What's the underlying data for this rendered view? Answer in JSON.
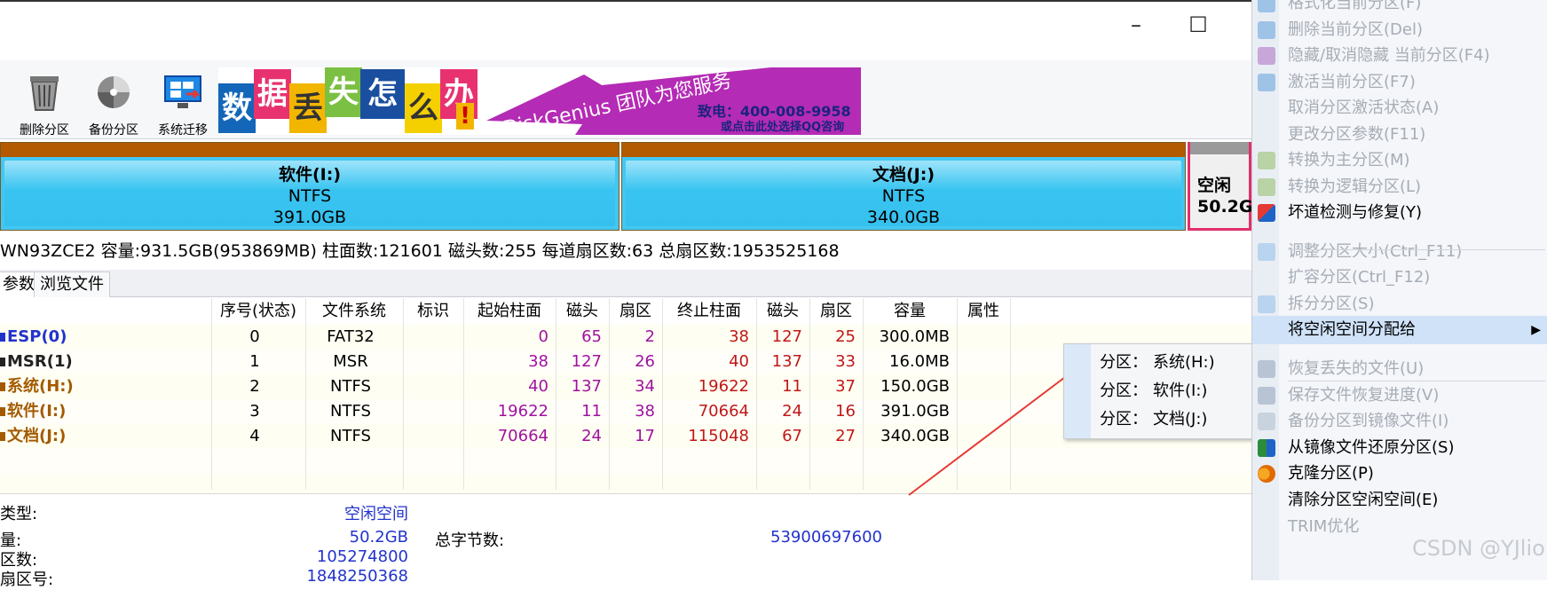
{
  "window": {
    "close_glyph": "✕",
    "maximize_glyph": "☐"
  },
  "toolbar": {
    "buttons": [
      {
        "label": "删除分区",
        "icon": "trash-icon"
      },
      {
        "label": "备份分区",
        "icon": "backup-icon"
      },
      {
        "label": "系统迁移",
        "icon": "system-migrate-icon"
      }
    ]
  },
  "banner": {
    "tiles": [
      "数",
      "据",
      "丢",
      "失",
      "怎",
      "么",
      "办",
      "!"
    ],
    "brand": "DiskGenius 团队为您服务",
    "phone": "致电：400-008-9958",
    "qq": "或点击此处选择QQ咨询"
  },
  "disk_map": {
    "partitions": [
      {
        "name": "软件(I:)",
        "fs": "NTFS",
        "size": "391.0GB"
      },
      {
        "name": "文档(J:)",
        "fs": "NTFS",
        "size": "340.0GB"
      },
      {
        "name": "空闲",
        "size": "50.2G"
      }
    ]
  },
  "disk_info": "WN93ZCE2  容量:931.5GB(953869MB)  柱面数:121601  磁头数:255  每道扇区数:63  总扇区数:1953525168",
  "tabs": [
    "参数",
    "浏览文件"
  ],
  "table": {
    "columns": [
      "序号(状态)",
      "文件系统",
      "标识",
      "起始柱面",
      "磁头",
      "扇区",
      "终止柱面",
      "磁头",
      "扇区",
      "容量",
      "属性"
    ],
    "rows": [
      {
        "name": "ESP(0)",
        "index": "0",
        "fs": "FAT32",
        "start_cyl": "0",
        "start_head": "65",
        "start_sec": "2",
        "end_cyl": "38",
        "end_head": "127",
        "end_sec": "25",
        "size": "300.0MB"
      },
      {
        "name": "MSR(1)",
        "index": "1",
        "fs": "MSR",
        "start_cyl": "38",
        "start_head": "127",
        "start_sec": "26",
        "end_cyl": "40",
        "end_head": "137",
        "end_sec": "33",
        "size": "16.0MB"
      },
      {
        "name": "系统(H:)",
        "index": "2",
        "fs": "NTFS",
        "start_cyl": "40",
        "start_head": "137",
        "start_sec": "34",
        "end_cyl": "19622",
        "end_head": "11",
        "end_sec": "37",
        "size": "150.0GB"
      },
      {
        "name": "软件(I:)",
        "index": "3",
        "fs": "NTFS",
        "start_cyl": "19622",
        "start_head": "11",
        "start_sec": "38",
        "end_cyl": "70664",
        "end_head": "24",
        "end_sec": "16",
        "size": "391.0GB"
      },
      {
        "name": "文档(J:)",
        "index": "4",
        "fs": "NTFS",
        "start_cyl": "70664",
        "start_head": "24",
        "start_sec": "17",
        "end_cyl": "115048",
        "end_head": "67",
        "end_sec": "27",
        "size": "340.0GB"
      }
    ]
  },
  "bottom_info": {
    "type_label": "类型:",
    "type_value": "空闲空间",
    "cap_label": "量:",
    "cap_value": "50.2GB",
    "total_bytes_label": "总字节数:",
    "total_bytes_value": "53900697600",
    "sectors_label": "区数:",
    "sectors_value": "105274800",
    "start_sector_label": "扇区号:",
    "start_sector_value": "1848250368"
  },
  "submenu": {
    "items": [
      {
        "prefix": "分区：",
        "value": "系统(H:)"
      },
      {
        "prefix": "分区：",
        "value": "软件(I:)"
      },
      {
        "prefix": "分区：",
        "value": "文档(J:)"
      }
    ]
  },
  "context_menu": {
    "items": [
      {
        "label": "格式化当前分区(F)",
        "enabled": false,
        "icon": "format-icon"
      },
      {
        "label": "删除当前分区(Del)",
        "enabled": false,
        "icon": "delete-icon"
      },
      {
        "label": "隐藏/取消隐藏 当前分区(F4)",
        "enabled": false,
        "icon": "hide-icon"
      },
      {
        "label": "激活当前分区(F7)",
        "enabled": false,
        "icon": "activate-icon"
      },
      {
        "label": "取消分区激活状态(A)",
        "enabled": false,
        "icon": ""
      },
      {
        "label": "更改分区参数(F11)",
        "enabled": false,
        "icon": ""
      },
      {
        "label": "转换为主分区(M)",
        "enabled": false,
        "icon": "convert-primary-icon"
      },
      {
        "label": "转换为逻辑分区(L)",
        "enabled": false,
        "icon": "convert-logical-icon"
      },
      {
        "label": "坏道检测与修复(Y)",
        "enabled": true,
        "icon": "repair-tools-icon"
      },
      {
        "label": "调整分区大小(Ctrl_F11)",
        "enabled": false,
        "icon": "resize-icon"
      },
      {
        "label": "扩容分区(Ctrl_F12)",
        "enabled": false,
        "icon": ""
      },
      {
        "label": "拆分分区(S)",
        "enabled": false,
        "icon": "split-icon"
      },
      {
        "label": "将空闲空间分配给",
        "enabled": true,
        "icon": "",
        "submenu_arrow": "▶"
      },
      {
        "label": "恢复丢失的文件(U)",
        "enabled": false,
        "icon": "recover-icon"
      },
      {
        "label": "保存文件恢复进度(V)",
        "enabled": false,
        "icon": "save-progress-icon"
      },
      {
        "label": "备份分区到镜像文件(I)",
        "enabled": false,
        "icon": "backup-image-icon"
      },
      {
        "label": "从镜像文件还原分区(S)",
        "enabled": true,
        "icon": "restore-image-icon"
      },
      {
        "label": "克隆分区(P)",
        "enabled": true,
        "icon": "clone-icon"
      },
      {
        "label": "清除分区空闲空间(E)",
        "enabled": true,
        "icon": ""
      },
      {
        "label": "TRIM优化",
        "enabled": false,
        "icon": ""
      }
    ]
  },
  "watermark": "CSDN @YJlio"
}
